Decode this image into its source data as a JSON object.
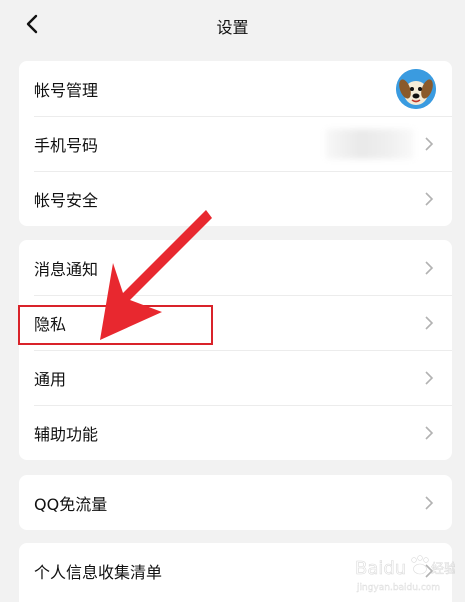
{
  "header": {
    "title": "设置"
  },
  "sections": [
    {
      "rows": [
        {
          "label": "帐号管理",
          "trailing": "avatar"
        },
        {
          "label": "手机号码",
          "trailing": "chevron"
        },
        {
          "label": "帐号安全",
          "trailing": "chevron"
        }
      ]
    },
    {
      "rows": [
        {
          "label": "消息通知",
          "trailing": "chevron"
        },
        {
          "label": "隐私",
          "trailing": "chevron"
        },
        {
          "label": "通用",
          "trailing": "chevron"
        },
        {
          "label": "辅助功能",
          "trailing": "chevron"
        }
      ]
    },
    {
      "rows": [
        {
          "label": "QQ免流量",
          "trailing": "chevron"
        }
      ]
    },
    {
      "rows": [
        {
          "label": "个人信息收集清单",
          "trailing": "chevron"
        }
      ]
    }
  ],
  "colors": {
    "background": "#f2f2f2",
    "card": "#ffffff",
    "annotation": "#d9232a",
    "chevron": "#b2b2b2"
  },
  "watermark": {
    "brand": "Baidu",
    "suffix": "经验",
    "url": "jingyan.baidu.com"
  }
}
